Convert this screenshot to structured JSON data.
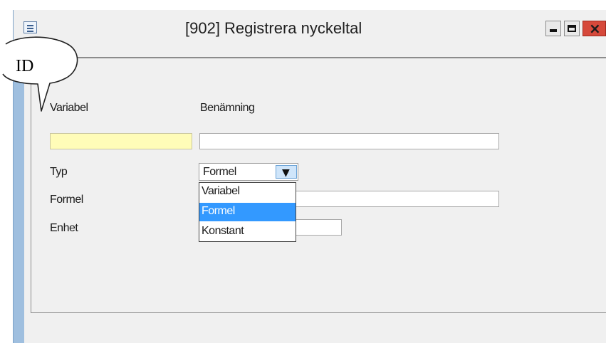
{
  "window": {
    "title": "[902]  Registrera nyckeltal",
    "controls": {
      "minimize": "minimize",
      "maximize": "maximize",
      "close": "close"
    }
  },
  "callout": {
    "text": "ID"
  },
  "form": {
    "variabel_label": "Variabel",
    "benamning_label": "Benämning",
    "variabel_value": "",
    "benamning_value": "",
    "typ_label": "Typ",
    "typ_value": "Formel",
    "formel_label": "Formel",
    "formel_value": "",
    "enhet_label": "Enhet",
    "enhet_value": ""
  },
  "dropdown": {
    "options": [
      "Variabel",
      "Formel",
      "Konstant"
    ],
    "selected": "Formel"
  },
  "colors": {
    "titlebar": "#f0f0f0",
    "frame": "#9fbfdf",
    "highlight": "#3399ff",
    "id_field": "#fffcb8",
    "close_button": "#d6493b"
  },
  "icons": {
    "system_menu": "window-menu-icon",
    "combo": "chevron-down-icon"
  }
}
